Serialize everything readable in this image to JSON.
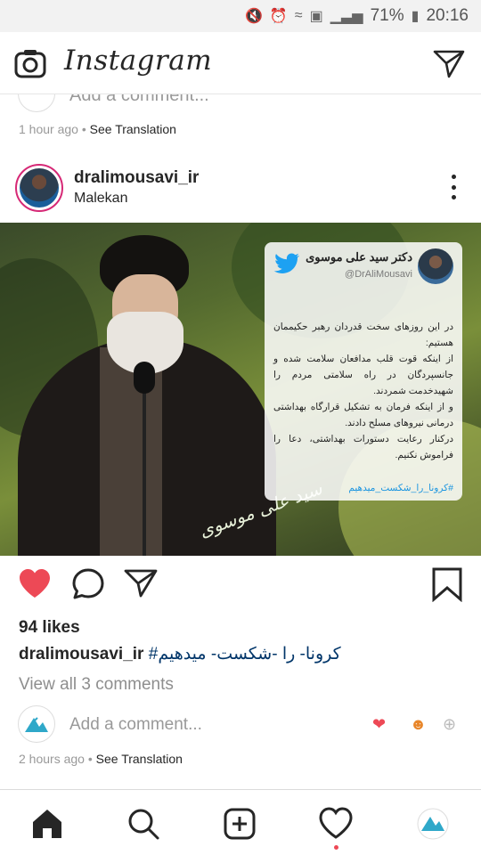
{
  "status_bar": {
    "battery": "71%",
    "time": "20:16"
  },
  "topbar": {
    "logo": "Instagram",
    "camera_icon": "camera-icon",
    "direct_icon": "direct-send-icon"
  },
  "previous_post": {
    "comment_placeholder": "Add a comment...",
    "time": "1 hour ago",
    "separator": "•",
    "see_translation": "See Translation"
  },
  "post": {
    "username": "dralimousavi_ir",
    "location": "Malekan",
    "tweet": {
      "name": "دکتر سید علی موسوی",
      "handle": "@DrAliMousavi",
      "body": [
        "در این روزهای سخت قدردان رهبر حکیممان هستیم:",
        "از اینکه قوت قلب مدافعان سلامت شده و جانسپردگان در راه سلامتی مردم را شهیدخدمت شمردند.",
        "و از اینکه فرمان به تشکیل قرارگاه بهداشتی درمانی نیروهای مسلح دادند.",
        "درکنار رعایت دستورات بهداشتی، دعا را فراموش نکنیم."
      ],
      "hashtag": "#کرونا_را_شکست_میدهیم"
    },
    "signature": "سید علی موسوی",
    "likes": "94 likes",
    "caption_user": "dralimousavi_ir",
    "caption_text": "#کرونا- را -شکست- میدهیم",
    "view_comments": "View all 3 comments",
    "comment_placeholder": "Add a comment...",
    "time": "2 hours ago",
    "separator": "•",
    "see_translation": "See Translation"
  },
  "colors": {
    "like_red": "#ed4956",
    "text": "#262626",
    "muted": "#8e8e8e",
    "hashtag": "#003569",
    "twitter_blue": "#1da1f2"
  },
  "nav": {
    "icons": [
      "home-icon",
      "search-icon",
      "new-post-icon",
      "activity-icon",
      "profile-icon"
    ]
  }
}
